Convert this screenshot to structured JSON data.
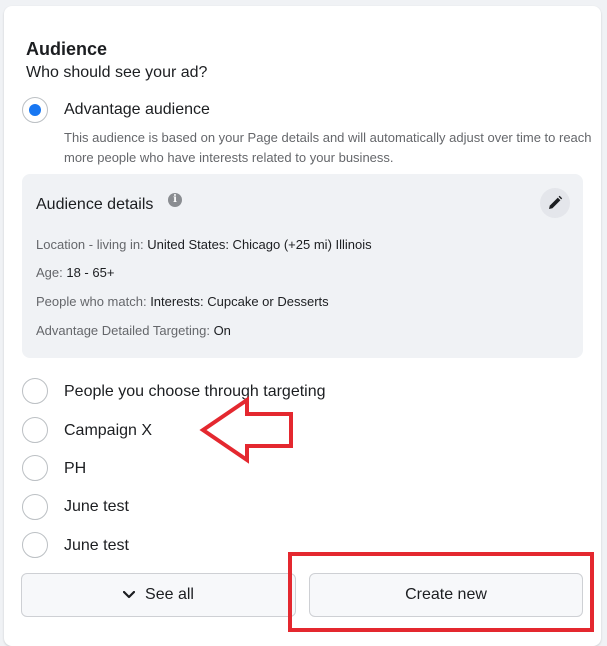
{
  "audience": {
    "title": "Audience",
    "subtitle": "Who should see your ad?",
    "advantage": {
      "label": "Advantage audience",
      "description": "This audience is based on your Page details and will automatically adjust over time to reach more people who have interests related to your business.",
      "selected": true
    },
    "details": {
      "title": "Audience details",
      "info_icon": "info-icon",
      "edit_icon": "pencil-icon",
      "rows": [
        {
          "label": "Location - living in: ",
          "value": "United States: Chicago (+25 mi) Illinois"
        },
        {
          "label": "Age: ",
          "value": "18 - 65+"
        },
        {
          "label": "People who match: ",
          "value": "Interests: Cupcake or Desserts"
        },
        {
          "label": "Advantage Detailed Targeting: ",
          "value": "On"
        }
      ]
    },
    "options": [
      {
        "label": "People you choose through targeting",
        "selected": false
      },
      {
        "label": "Campaign X",
        "selected": false
      },
      {
        "label": "PH",
        "selected": false
      },
      {
        "label": "June test",
        "selected": false
      },
      {
        "label": "June test",
        "selected": false
      }
    ],
    "buttons": {
      "see_all": "See all",
      "create_new": "Create new"
    }
  },
  "annotations": {
    "highlight_color": "#e4282f"
  },
  "colors": {
    "accent": "#1877f2"
  }
}
